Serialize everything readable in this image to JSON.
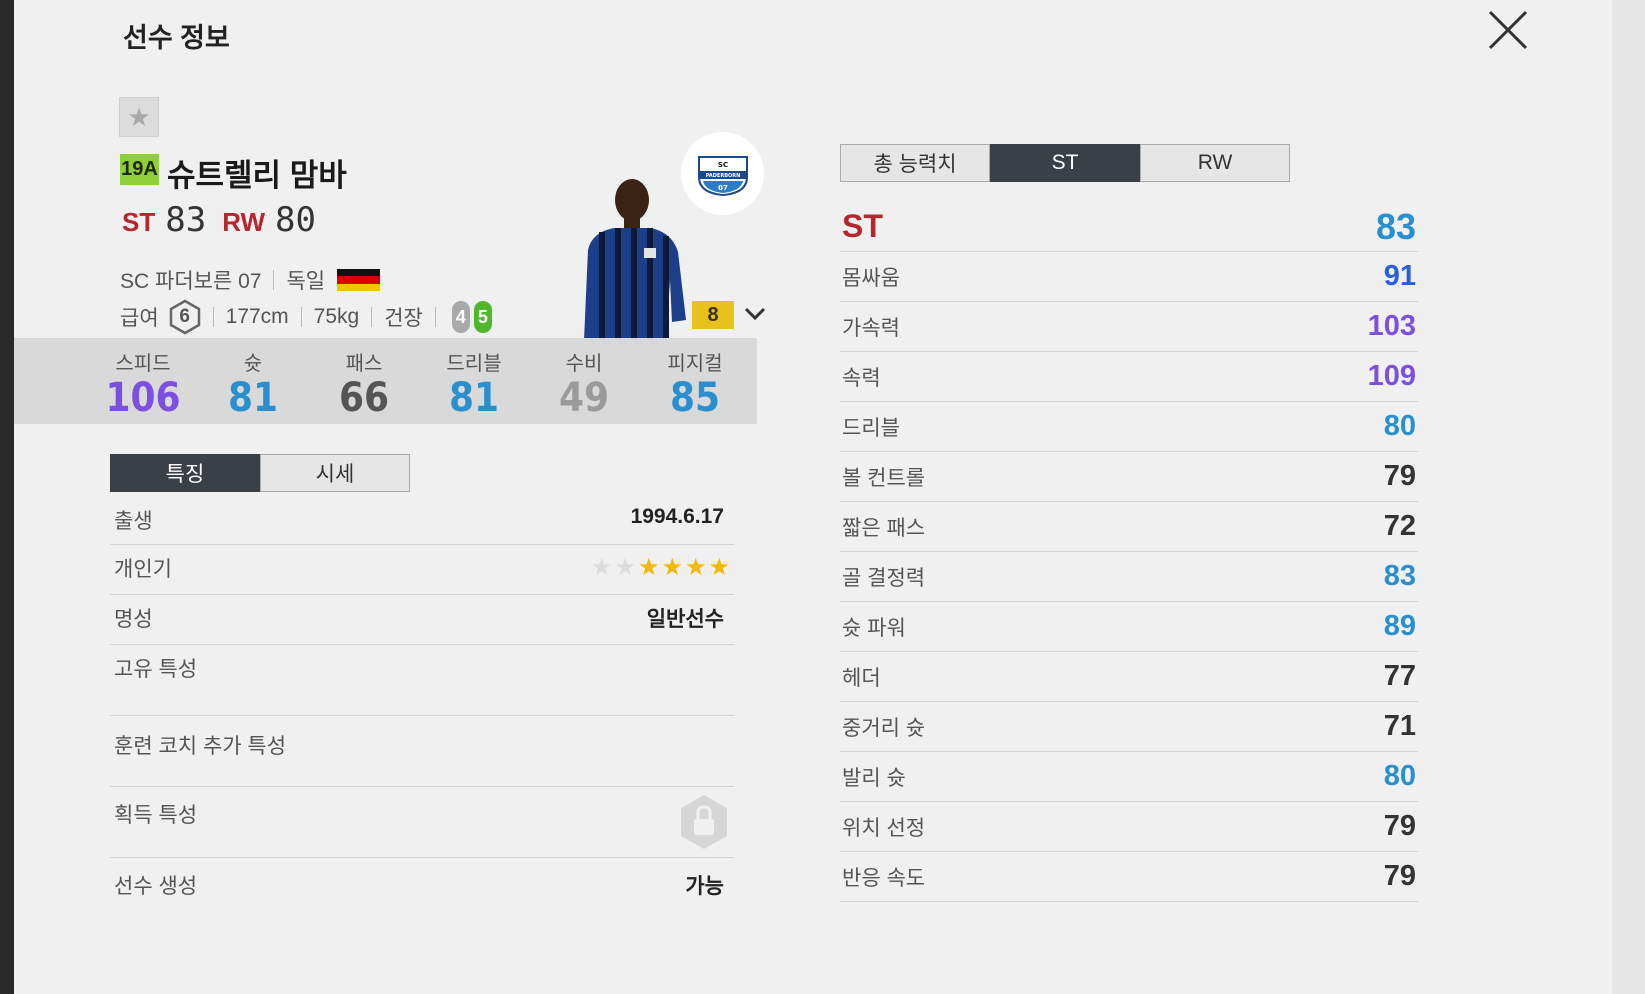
{
  "modal": {
    "title": "선수 정보"
  },
  "player": {
    "season": "19A",
    "name": "슈트렐리 맘바",
    "positions": [
      {
        "label": "ST",
        "value": "83"
      },
      {
        "label": "RW",
        "value": "80"
      }
    ],
    "club": "SC 파더보른 07",
    "nation": "독일",
    "salary_label": "급여",
    "salary": "6",
    "height": "177cm",
    "weight": "75kg",
    "build": "건장",
    "weak_foot": "4",
    "strong_foot": "5",
    "level": "8",
    "club_logo_text_1": "SC",
    "club_logo_text_2": "PADERBORN",
    "club_logo_text_3": "07"
  },
  "summary_stats": [
    {
      "label": "스피드",
      "value": "106",
      "color": "#7b4fe0"
    },
    {
      "label": "슛",
      "value": "81",
      "color": "#2a8fcf"
    },
    {
      "label": "패스",
      "value": "66",
      "color": "#555555"
    },
    {
      "label": "드리블",
      "value": "81",
      "color": "#2a8fcf"
    },
    {
      "label": "수비",
      "value": "49",
      "color": "#9a9a9a"
    },
    {
      "label": "피지컬",
      "value": "85",
      "color": "#2a8fcf"
    }
  ],
  "left_tabs": [
    {
      "label": "특징",
      "active": true
    },
    {
      "label": "시세",
      "active": false
    }
  ],
  "traits": {
    "birth_label": "출생",
    "birth": "1994.6.17",
    "skill_label": "개인기",
    "skill_stars": 4,
    "fame_label": "명성",
    "fame": "일반선수",
    "unique_label": "고유 특성",
    "coach_label": "훈련 코치 추가 특성",
    "acquired_label": "획득 특성",
    "create_label": "선수 생성",
    "create": "가능"
  },
  "right_tabs": [
    {
      "label": "총 능력치",
      "active": false
    },
    {
      "label": "ST",
      "active": true
    },
    {
      "label": "RW",
      "active": false
    }
  ],
  "attributes": {
    "head_label": "ST",
    "head_value": "83",
    "rows": [
      {
        "label": "몸싸움",
        "value": "91",
        "color": "#2a5fd9"
      },
      {
        "label": "가속력",
        "value": "103",
        "color": "#7b4fe0"
      },
      {
        "label": "속력",
        "value": "109",
        "color": "#7b4fe0"
      },
      {
        "label": "드리블",
        "value": "80",
        "color": "#2a8fcf"
      },
      {
        "label": "볼 컨트롤",
        "value": "79",
        "color": "#333333"
      },
      {
        "label": "짧은 패스",
        "value": "72",
        "color": "#333333"
      },
      {
        "label": "골 결정력",
        "value": "83",
        "color": "#2a8fcf"
      },
      {
        "label": "슛 파워",
        "value": "89",
        "color": "#2a8fcf"
      },
      {
        "label": "헤더",
        "value": "77",
        "color": "#333333"
      },
      {
        "label": "중거리 슛",
        "value": "71",
        "color": "#333333"
      },
      {
        "label": "발리 슛",
        "value": "80",
        "color": "#2a8fcf"
      },
      {
        "label": "위치 선정",
        "value": "79",
        "color": "#333333"
      },
      {
        "label": "반응 속도",
        "value": "79",
        "color": "#333333"
      }
    ]
  }
}
